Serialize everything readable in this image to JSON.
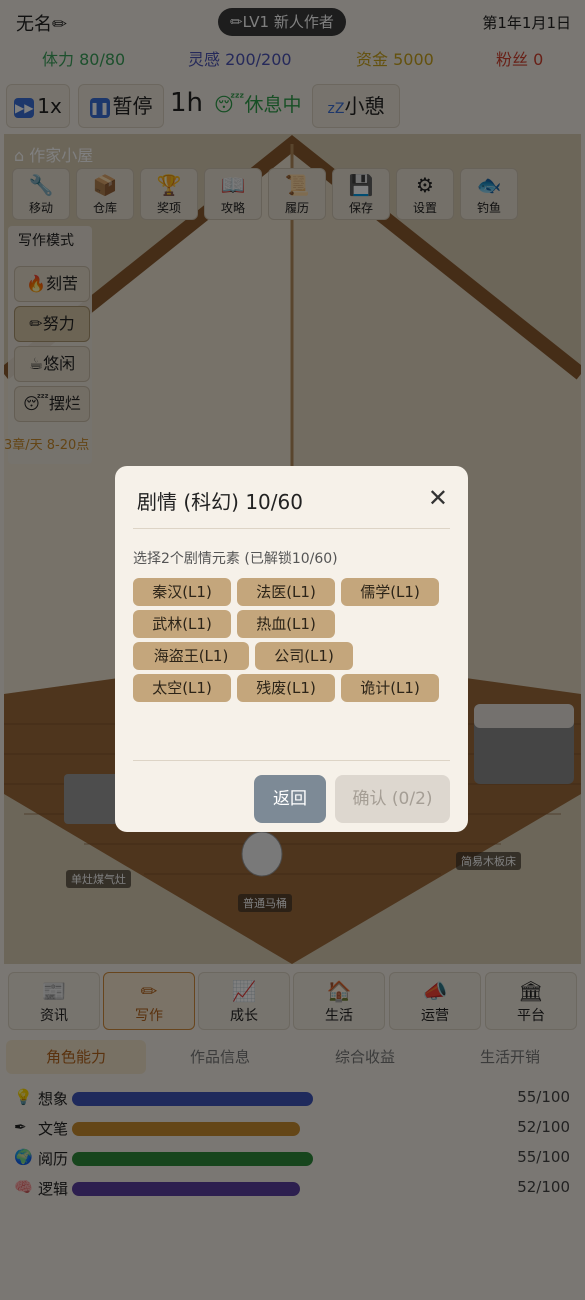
{
  "header": {
    "player_name": "无名",
    "level": "LV1 新人作者",
    "date": "第1年1月1日"
  },
  "stats": {
    "stamina": "体力 80/80",
    "inspiration": "灵感 200/200",
    "money": "资金 5000",
    "fans": "粉丝 0"
  },
  "toolbar": {
    "speed": "1x",
    "pause": "暂停",
    "timer": "1h",
    "rest_status": "休息中",
    "nap": "小憩"
  },
  "house": {
    "title": "作家小屋",
    "tools": [
      {
        "label": "移动",
        "icon": "wrench-icon",
        "glyph": "🔧"
      },
      {
        "label": "仓库",
        "icon": "box-icon",
        "glyph": "📦"
      },
      {
        "label": "奖项",
        "icon": "trophy-icon",
        "glyph": "🏆"
      },
      {
        "label": "攻略",
        "icon": "book-icon",
        "glyph": "📖"
      },
      {
        "label": "履历",
        "icon": "scroll-icon",
        "glyph": "📜"
      },
      {
        "label": "保存",
        "icon": "save-icon",
        "glyph": "💾"
      },
      {
        "label": "设置",
        "icon": "gear-icon",
        "glyph": "⚙"
      },
      {
        "label": "钓鱼",
        "icon": "fish-icon",
        "glyph": "🐟"
      }
    ],
    "writing_mode": {
      "title": "写作模式",
      "modes": [
        "刻苦",
        "努力",
        "悠闲",
        "摆烂"
      ],
      "active": "努力",
      "rate": "3章/天 8-20点"
    },
    "furniture": {
      "stove": "单灶煤气灶",
      "toilet": "普通马桶",
      "bed": "简易木板床"
    }
  },
  "bottom_nav": {
    "items": [
      "资讯",
      "写作",
      "成长",
      "生活",
      "运营",
      "平台"
    ],
    "active": "写作"
  },
  "sub_tabs": {
    "items": [
      "角色能力",
      "作品信息",
      "综合收益",
      "生活开销"
    ],
    "active": "角色能力"
  },
  "abilities": [
    {
      "name": "想象",
      "value": "55/100",
      "fraction": 0.55,
      "color": "#3f55b8",
      "icon": "bulb-icon"
    },
    {
      "name": "文笔",
      "value": "52/100",
      "fraction": 0.52,
      "color": "#c98d2e",
      "icon": "pen-icon"
    },
    {
      "name": "阅历",
      "value": "55/100",
      "fraction": 0.55,
      "color": "#2f8a3a",
      "icon": "globe-icon"
    },
    {
      "name": "逻辑",
      "value": "52/100",
      "fraction": 0.52,
      "color": "#5b3f9e",
      "icon": "brain-icon"
    }
  ],
  "modal": {
    "title": "剧情 (科幻) 10/60",
    "hint": "选择2个剧情元素 (已解锁10/60)",
    "chips": [
      "秦汉(L1)",
      "法医(L1)",
      "儒学(L1)",
      "武林(L1)",
      "热血(L1)",
      "海盗王(L1)",
      "公司(L1)",
      "太空(L1)",
      "残废(L1)",
      "诡计(L1)"
    ],
    "back": "返回",
    "confirm": "确认 (0/2)"
  }
}
